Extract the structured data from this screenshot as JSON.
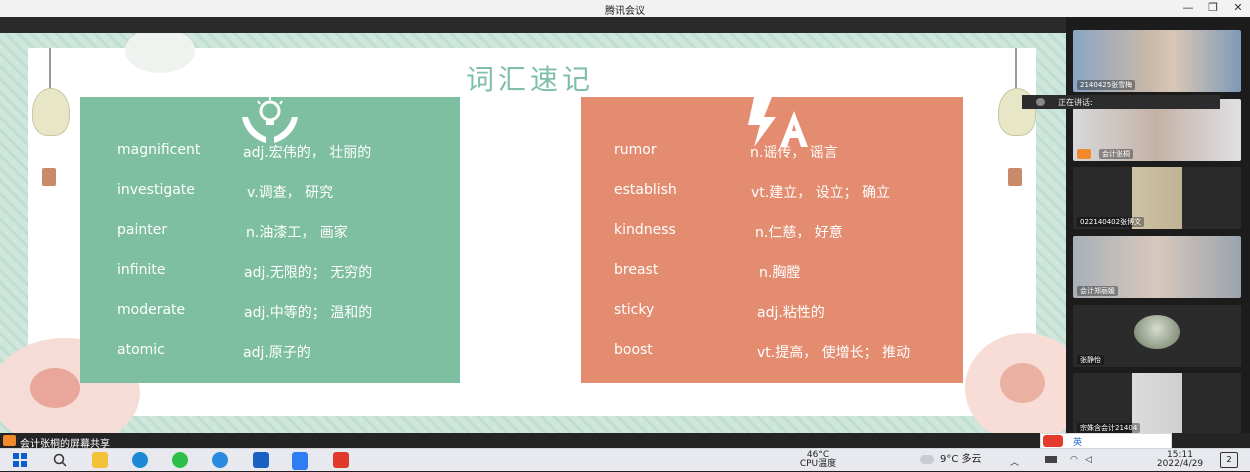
{
  "window": {
    "title": "腾讯会议"
  },
  "slide": {
    "title": "词汇速记",
    "left_words": [
      {
        "word": "magnificent",
        "def": "adj.宏伟的， 壮丽的"
      },
      {
        "word": "investigate",
        "def": "v.调查， 研究"
      },
      {
        "word": "painter",
        "def": "n.油漆工， 画家"
      },
      {
        "word": "infinite",
        "def": "adj.无限的； 无穷的"
      },
      {
        "word": "moderate",
        "def": "adj.中等的； 温和的"
      },
      {
        "word": "atomic",
        "def": "adj.原子的"
      }
    ],
    "right_words": [
      {
        "word": "rumor",
        "def": "n.谣传， 谣言"
      },
      {
        "word": "establish",
        "def": "vt.建立， 设立； 确立"
      },
      {
        "word": "kindness",
        "def": "n.仁慈， 好意"
      },
      {
        "word": "breast",
        "def": "n.胸膛"
      },
      {
        "word": "sticky",
        "def": "adj.粘性的"
      },
      {
        "word": "boost",
        "def": "vt.提高， 使增长； 推动"
      }
    ],
    "colors": {
      "green": "#7ebfa1",
      "orange": "#e38c70"
    }
  },
  "participants": [
    {
      "name": "2140425张雪梅"
    },
    {
      "name": "会计张桐"
    },
    {
      "name": "022140402张博文"
    },
    {
      "name": "会计郑丽媛"
    },
    {
      "name": "张静怡"
    },
    {
      "name": "宗姝含会计21404"
    }
  ],
  "speaking": {
    "label": "正在讲话:"
  },
  "share_bar": {
    "text": "会计张桐的屏幕共享"
  },
  "taskbar": {
    "cpu_temp": "46°C",
    "cpu_label": "CPU温度",
    "weather": "9°C 多云",
    "time": "15:11",
    "date": "2022/4/29",
    "notif_count": "2",
    "ime_lang": "英"
  },
  "icons": [
    "lightbulb-hands-icon",
    "bolt-a-icon",
    "windows-start-icon",
    "search-icon",
    "file-explorer-icon",
    "edge-icon",
    "wechat-icon",
    "ie-icon",
    "defender-icon",
    "tencent-meeting-icon",
    "wps-icon"
  ]
}
